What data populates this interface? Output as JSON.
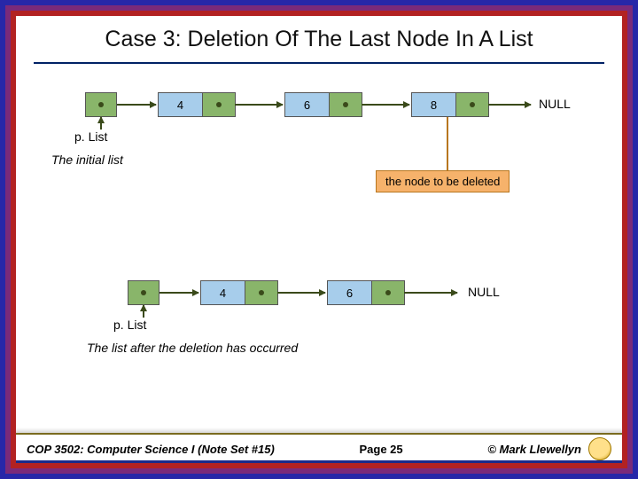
{
  "title": "Case 3: Deletion Of The Last Node In A List",
  "list1": {
    "head_label": "p. List",
    "nodes": [
      {
        "value": "4"
      },
      {
        "value": "6"
      },
      {
        "value": "8"
      }
    ],
    "null_label": "NULL",
    "caption": "The initial list",
    "annotation": "the node to be deleted"
  },
  "list2": {
    "head_label": "p. List",
    "nodes": [
      {
        "value": "4"
      },
      {
        "value": "6"
      }
    ],
    "null_label": "NULL",
    "caption": "The list after the deletion has occurred"
  },
  "footer": {
    "left": "COP 3502: Computer Science I   (Note Set #15)",
    "center": "Page 25",
    "right": "© Mark Llewellyn"
  }
}
